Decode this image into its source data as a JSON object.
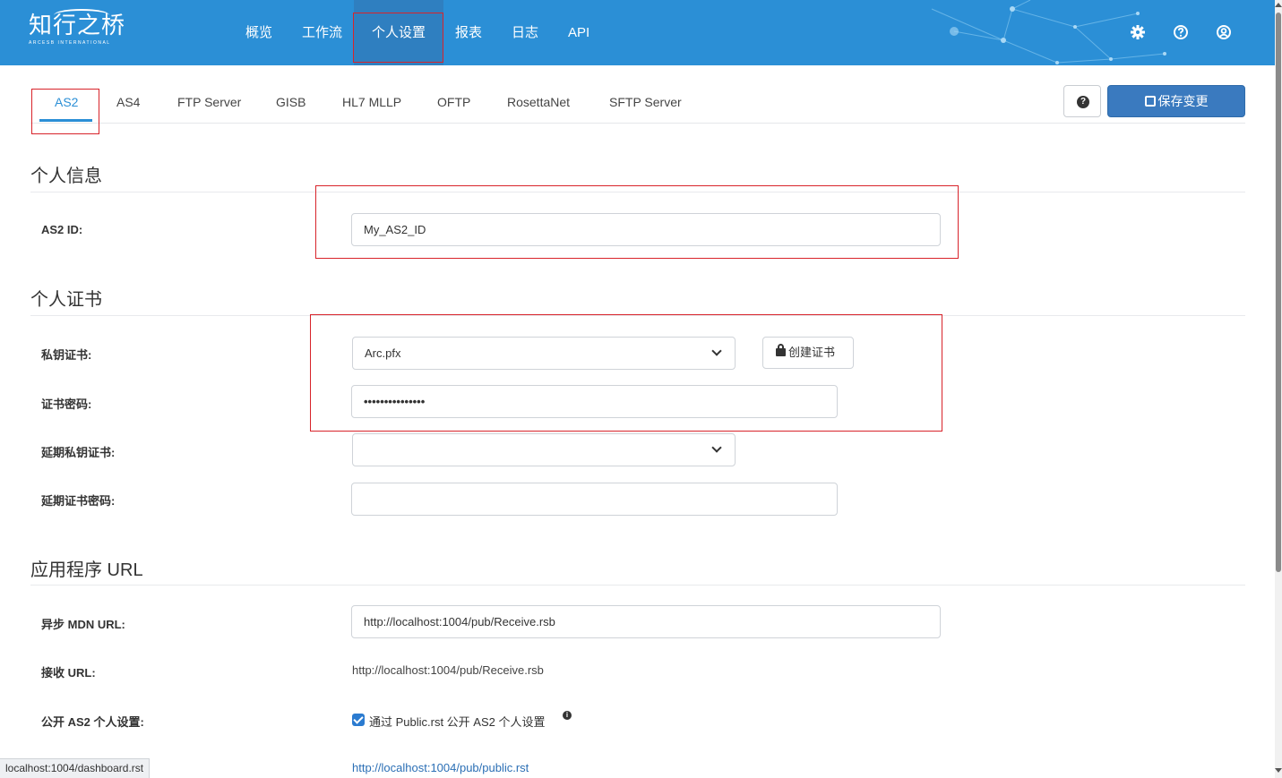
{
  "brand": {
    "name": "知行之桥",
    "tagline": "ARCESB INTERNATIONAL"
  },
  "nav": {
    "items": [
      "概览",
      "工作流",
      "个人设置",
      "报表",
      "日志",
      "API"
    ],
    "active": "个人设置",
    "icons": [
      "gear-icon",
      "question-circle-icon",
      "user-circle-icon"
    ]
  },
  "tabs": {
    "items": [
      "AS2",
      "AS4",
      "FTP Server",
      "GISB",
      "HL7 MLLP",
      "OFTP",
      "RosettaNet",
      "SFTP Server"
    ],
    "active": "AS2"
  },
  "toolbar": {
    "help_icon": "?",
    "save_label": "保存变更"
  },
  "profile": {
    "section_title": "个人信息",
    "as2_id_label": "AS2 ID:",
    "as2_id_value": "My_AS2_ID"
  },
  "certificate": {
    "section_title": "个人证书",
    "private_cert_label": "私钥证书:",
    "private_cert_value": "Arc.pfx",
    "create_cert_label": "创建证书",
    "cert_password_label": "证书密码:",
    "cert_password_value": "•••••••••••••••",
    "ext_private_cert_label": "延期私钥证书:",
    "ext_private_cert_value": "",
    "ext_cert_password_label": "延期证书密码:",
    "ext_cert_password_value": ""
  },
  "app_url": {
    "section_title": "应用程序 URL",
    "async_mdn_label": "异步 MDN URL:",
    "async_mdn_value": "http://localhost:1004/pub/Receive.rsb",
    "receive_label": "接收 URL:",
    "receive_value": "http://localhost:1004/pub/Receive.rsb",
    "public_label": "公开 AS2 个人设置:",
    "public_checkbox_label": "通过 Public.rst 公开 AS2 个人设置",
    "public_checked": true,
    "public_link": "http://localhost:1004/pub/public.rst"
  },
  "status_bar": {
    "url": "localhost:1004/dashboard.rst"
  },
  "colors": {
    "navbar": "#2b8fd6",
    "accent": "#2b8fd6",
    "save_button": "#3a7abf",
    "highlight": "#d8232a"
  }
}
